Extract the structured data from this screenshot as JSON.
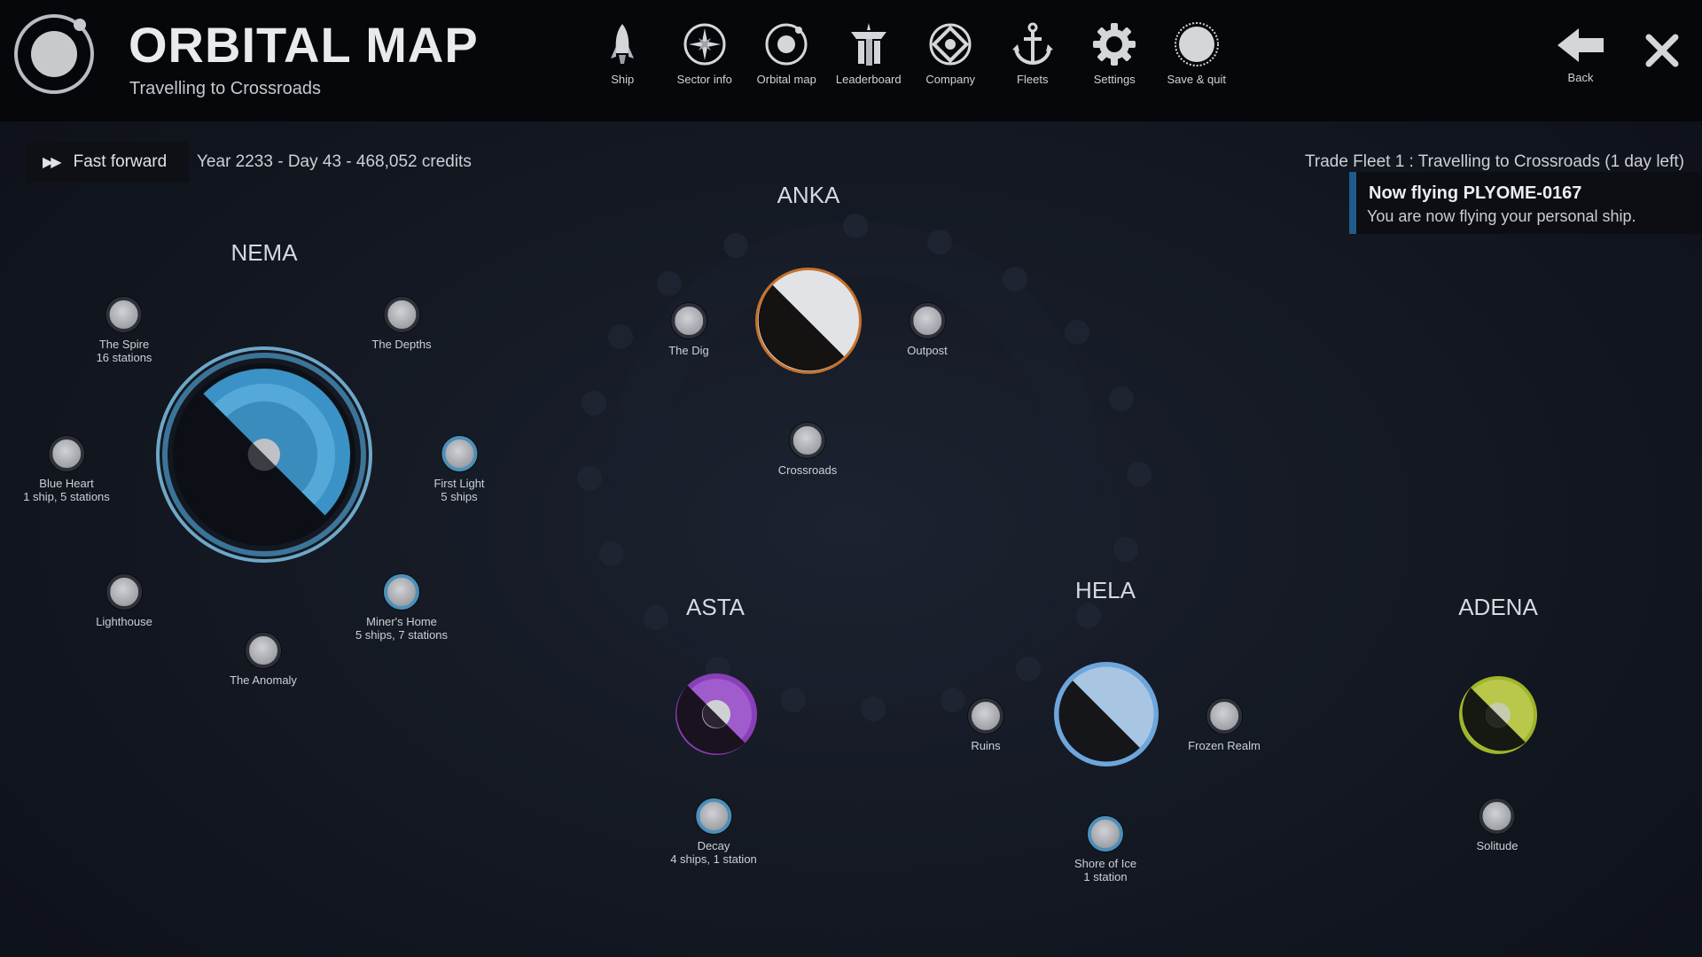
{
  "header": {
    "title": "ORBITAL MAP",
    "subtitle": "Travelling to Crossroads",
    "logo_icon": "planet-logo-icon"
  },
  "nav": [
    {
      "label": "Ship",
      "icon": "rocket-icon"
    },
    {
      "label": "Sector info",
      "icon": "compass-star-icon"
    },
    {
      "label": "Orbital map",
      "icon": "orbit-icon"
    },
    {
      "label": "Leaderboard",
      "icon": "podium-icon"
    },
    {
      "label": "Company",
      "icon": "company-emblem-icon"
    },
    {
      "label": "Fleets",
      "icon": "anchor-icon"
    },
    {
      "label": "Settings",
      "icon": "gear-icon"
    },
    {
      "label": "Save & quit",
      "icon": "save-quit-icon"
    }
  ],
  "back": {
    "label": "Back",
    "icon": "arrow-left-icon"
  },
  "close_icon": "close-icon",
  "toolbar": {
    "fast_forward_label": "Fast forward",
    "fast_forward_icon": "fast-forward-icon",
    "status": "Year 2233 - Day 43 - 468,052 credits",
    "fleet_status": "Trade Fleet 1 : Travelling to Crossroads (1 day left)"
  },
  "notification": {
    "title": "Now flying PLYOME-0167",
    "text": "You are now flying your personal ship."
  },
  "systems": {
    "nema": {
      "name": "NEMA",
      "star_color": "#3f9ccf",
      "locations": [
        {
          "name": "The Spire",
          "detail": "16 stations",
          "fleet": false
        },
        {
          "name": "The Depths",
          "detail": "",
          "fleet": false
        },
        {
          "name": "Blue Heart",
          "detail": "1 ship, 5 stations",
          "fleet": false
        },
        {
          "name": "First Light",
          "detail": "5 ships",
          "fleet": true
        },
        {
          "name": "Lighthouse",
          "detail": "",
          "fleet": false
        },
        {
          "name": "Miner's Home",
          "detail": "5 ships, 7 stations",
          "fleet": true
        },
        {
          "name": "The Anomaly",
          "detail": "",
          "fleet": false
        }
      ]
    },
    "anka": {
      "name": "ANKA",
      "star_color": "#d97a2b",
      "locations": [
        {
          "name": "The Dig",
          "detail": "",
          "fleet": false
        },
        {
          "name": "Outpost",
          "detail": "",
          "fleet": false
        },
        {
          "name": "Crossroads",
          "detail": "",
          "fleet": false
        }
      ]
    },
    "asta": {
      "name": "ASTA",
      "star_color": "#8a3fb8",
      "locations": [
        {
          "name": "Decay",
          "detail": "4 ships, 1 station",
          "fleet": true
        }
      ]
    },
    "hela": {
      "name": "HELA",
      "star_color": "#6ea6dc",
      "locations": [
        {
          "name": "Ruins",
          "detail": "",
          "fleet": false
        },
        {
          "name": "Frozen Realm",
          "detail": "",
          "fleet": false
        },
        {
          "name": "Shore of Ice",
          "detail": "1 station",
          "fleet": true
        }
      ]
    },
    "adena": {
      "name": "ADENA",
      "star_color": "#9fb52a",
      "locations": [
        {
          "name": "Solitude",
          "detail": "",
          "fleet": false
        }
      ]
    }
  }
}
